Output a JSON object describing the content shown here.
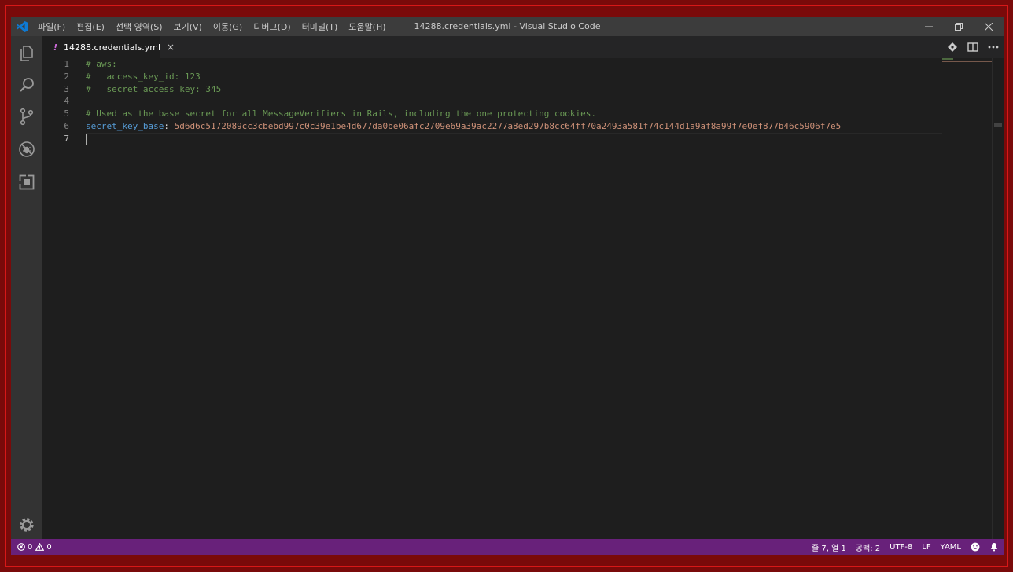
{
  "window": {
    "title": "14288.credentials.yml - Visual Studio Code",
    "menu": [
      "파일(F)",
      "편집(E)",
      "선택 영역(S)",
      "보기(V)",
      "이동(G)",
      "디버그(D)",
      "터미널(T)",
      "도움말(H)"
    ]
  },
  "tab": {
    "modified_marker": "!",
    "filename": "14288.credentials.yml",
    "close_glyph": "×"
  },
  "editor": {
    "line_numbers": [
      "1",
      "2",
      "3",
      "4",
      "5",
      "6",
      "7"
    ],
    "lines": [
      {
        "comment": "# aws:"
      },
      {
        "comment": "#   access_key_id: 123"
      },
      {
        "comment": "#   secret_access_key: 345"
      },
      {
        "comment": ""
      },
      {
        "comment": "# Used as the base secret for all MessageVerifiers in Rails, including the one protecting cookies."
      },
      {
        "key": "secret_key_base",
        "sep": ": ",
        "value": "5d6d6c5172089cc3cbebd997c0c39e1be4d677da0be06afc2709e69a39ac2277a8ed297b8cc64ff70a2493a581f74c144d1a9af8a99f7e0ef877b46c5906f7e5"
      },
      {
        "comment": ""
      }
    ]
  },
  "status": {
    "errors": "0",
    "warnings": "0",
    "position": "줄 7, 열 1",
    "indent": "공백: 2",
    "encoding": "UTF-8",
    "eol": "LF",
    "language": "YAML"
  },
  "colors": {
    "statusbar": "#68217a",
    "comment": "#6a9955",
    "key": "#569cd6",
    "value": "#ce9178"
  }
}
